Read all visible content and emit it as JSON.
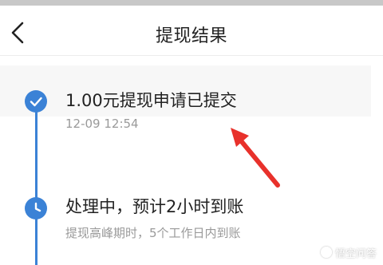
{
  "header": {
    "back_icon": "chevron-left-icon",
    "title": "提现结果"
  },
  "timeline": {
    "accent_color": "#3b82d6",
    "steps": [
      {
        "icon": "check-icon",
        "title": "1.00元提现申请已提交",
        "subtitle": "12-09 12:54",
        "status": "completed"
      },
      {
        "icon": "clock-icon",
        "title": "处理中，预计2小时到账",
        "subtitle": "提现高峰期时，5个工作日内到账",
        "status": "in-progress"
      }
    ]
  },
  "annotation": {
    "type": "arrow",
    "color": "#e8312b"
  },
  "watermark": {
    "text": "悟空问答"
  }
}
